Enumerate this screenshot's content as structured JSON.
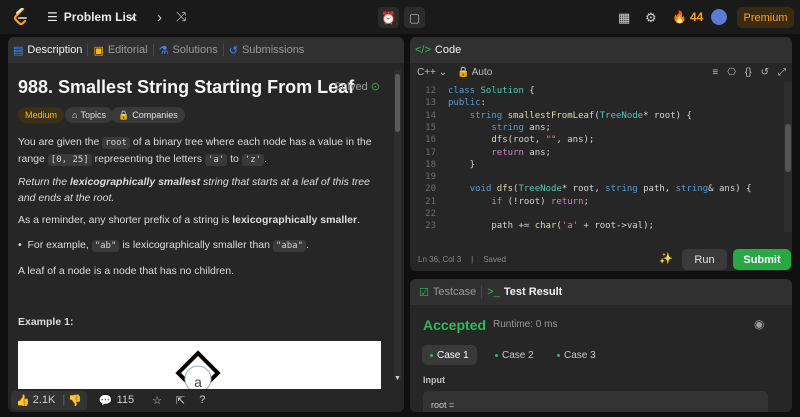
{
  "topbar": {
    "nav_label": "Problem List",
    "streak": "44",
    "premium": "Premium",
    "icons": [
      "list-icon",
      "chevron-left-icon",
      "chevron-right-icon",
      "shuffle-icon",
      "alarm-icon",
      "note-icon",
      "grid-icon",
      "gear-icon",
      "fire-icon",
      "avatar"
    ]
  },
  "left_tabs": {
    "description": "Description",
    "editorial": "Editorial",
    "solutions": "Solutions",
    "submissions": "Submissions"
  },
  "problem": {
    "title": "988. Smallest String Starting From Leaf",
    "status": "Solved",
    "difficulty": "Medium",
    "topics": "Topics",
    "companies": "Companies",
    "p1_a": "You are given the ",
    "p1_code_root": "root",
    "p1_b": " of a binary tree where each node has a value in the range ",
    "p1_code_range": "[0, 25]",
    "p1_c": " representing the letters ",
    "p1_code_a": "'a'",
    "p1_d": " to ",
    "p1_code_z": "'z'",
    "p1_e": ".",
    "p2_a": "Return the ",
    "p2_b": "lexicographically smallest",
    "p2_c": " string that starts at a leaf of this tree and ends at the root.",
    "p3_a": "As a reminder, any shorter prefix of a string is ",
    "p3_b": "lexicographically smaller",
    "p3_c": ".",
    "bullet_a": "For example, ",
    "bullet_code1": "\"ab\"",
    "bullet_b": " is lexicographically smaller than ",
    "bullet_code2": "\"aba\"",
    "bullet_c": ".",
    "p4": "A leaf of a node is a node that has no children.",
    "example": "Example 1:",
    "node_label": "a"
  },
  "bottom": {
    "likes": "2.1K",
    "comments": "115"
  },
  "code_panel": {
    "title": "Code",
    "language": "C++",
    "mode": "Auto",
    "status_pos": "Ln 36, Col 3",
    "status_saved": "Saved",
    "run": "Run",
    "submit": "Submit",
    "lines": [
      {
        "n": "12",
        "parts": [
          [
            "k",
            "class "
          ],
          [
            "t",
            "Solution"
          ],
          [
            "v",
            " {"
          ]
        ]
      },
      {
        "n": "13",
        "parts": [
          [
            "k",
            "public"
          ],
          [
            "v",
            ":"
          ]
        ]
      },
      {
        "n": "14",
        "parts": [
          [
            "v",
            "    "
          ],
          [
            "k",
            "string "
          ],
          [
            "f",
            "smallestFromLeaf"
          ],
          [
            "v",
            "("
          ],
          [
            "t",
            "TreeNode"
          ],
          [
            "v",
            "* root) {"
          ]
        ]
      },
      {
        "n": "15",
        "parts": [
          [
            "v",
            "        "
          ],
          [
            "k",
            "string "
          ],
          [
            "v",
            "ans;"
          ]
        ]
      },
      {
        "n": "16",
        "parts": [
          [
            "v",
            "        "
          ],
          [
            "f",
            "dfs"
          ],
          [
            "v",
            "(root, "
          ],
          [
            "s",
            "\"\""
          ],
          [
            "v",
            ", ans);"
          ]
        ]
      },
      {
        "n": "17",
        "parts": [
          [
            "v",
            "        "
          ],
          [
            "p",
            "return "
          ],
          [
            "v",
            "ans;"
          ]
        ]
      },
      {
        "n": "18",
        "parts": [
          [
            "v",
            "    }"
          ]
        ]
      },
      {
        "n": "19",
        "parts": [
          [
            "v",
            ""
          ]
        ]
      },
      {
        "n": "20",
        "parts": [
          [
            "v",
            "    "
          ],
          [
            "k",
            "void "
          ],
          [
            "f",
            "dfs"
          ],
          [
            "v",
            "("
          ],
          [
            "t",
            "TreeNode"
          ],
          [
            "v",
            "* root, "
          ],
          [
            "k",
            "string "
          ],
          [
            "v",
            "path, "
          ],
          [
            "k",
            "string"
          ],
          [
            "v",
            "& ans) {"
          ]
        ]
      },
      {
        "n": "21",
        "parts": [
          [
            "v",
            "        "
          ],
          [
            "p",
            "if "
          ],
          [
            "v",
            "(!root) "
          ],
          [
            "p",
            "return"
          ],
          [
            "v",
            ";"
          ]
        ]
      },
      {
        "n": "22",
        "parts": [
          [
            "v",
            ""
          ]
        ]
      },
      {
        "n": "23",
        "parts": [
          [
            "v",
            "        path += "
          ],
          [
            "f",
            "char"
          ],
          [
            "v",
            "("
          ],
          [
            "s",
            "'a'"
          ],
          [
            "v",
            " + root->val);"
          ]
        ]
      }
    ]
  },
  "result_panel": {
    "tab_testcase": "Testcase",
    "tab_result": "Test Result",
    "verdict": "Accepted",
    "runtime": "Runtime: 0 ms",
    "cases": [
      "Case 1",
      "Case 2",
      "Case 3"
    ],
    "input_label": "Input",
    "input_value": "root ="
  },
  "colors": {
    "accent_green": "#2cbb5d",
    "accent_orange": "#ffa116",
    "submit_green": "#28a745",
    "medium_yellow": "#ffb800"
  }
}
